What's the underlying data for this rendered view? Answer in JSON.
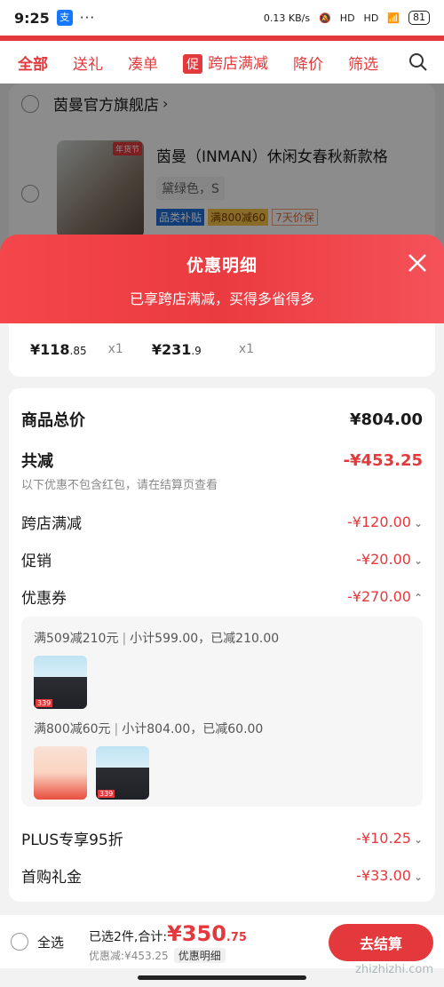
{
  "status_bar": {
    "time": "9:25",
    "app_badge": "支",
    "dots": "···",
    "net_speed": "0.13 KB/s",
    "signal1": "HD",
    "signal2": "HD",
    "battery": "81"
  },
  "tabs": [
    {
      "label": "全部",
      "active": true
    },
    {
      "label": "送礼"
    },
    {
      "label": "凑单"
    },
    {
      "label": "跨店满减",
      "tag": "促"
    },
    {
      "label": "降价"
    },
    {
      "label": "筛选"
    }
  ],
  "store": {
    "name": "茵曼官方旗舰店",
    "product_title": "茵曼（INMAN）休闲女春秋新款格",
    "thumb_label": "年货节",
    "sku": "黛绿色，S",
    "badges": [
      "品类补贴",
      "满800减60",
      "7天价保"
    ]
  },
  "popup": {
    "title": "优惠明细",
    "subtitle": "已享跨店满减，买得多省得多"
  },
  "prices": [
    {
      "main": "¥118",
      "decimal": ".85",
      "qty": "x1"
    },
    {
      "main": "¥231",
      "decimal": ".9",
      "qty": "x1"
    }
  ],
  "details": {
    "total_label": "商品总价",
    "total_value": "¥804.00",
    "reduce_label": "共减",
    "reduce_value": "-¥453.25",
    "note": "以下优惠不包含红包，请在结算页查看",
    "cross_store_label": "跨店满减",
    "cross_store_value": "-¥120.00",
    "promo_label": "促销",
    "promo_value": "-¥20.00",
    "coupon_label": "优惠券",
    "coupon_value": "-¥270.00",
    "plus_label": "PLUS专享95折",
    "plus_value": "-¥10.25",
    "first_label": "首购礼金",
    "first_value": "-¥33.00"
  },
  "coupons": [
    {
      "rule": "满509减210元",
      "subtotal": "小计599.00，已减210.00",
      "thumbs": [
        {
          "kind": "jacket",
          "price": "339"
        }
      ]
    },
    {
      "rule": "满800减60元",
      "subtotal": "小计804.00，已减60.00",
      "thumbs": [
        {
          "kind": "supp",
          "price": ""
        },
        {
          "kind": "jacket",
          "price": "339"
        }
      ]
    }
  ],
  "bottom": {
    "select_all": "全选",
    "selected": "已选2件,合计:",
    "amount_main": "¥350",
    "amount_dec": ".75",
    "discount": "优惠减:¥453.25",
    "detail_btn": "优惠明细",
    "checkout": "去结算"
  },
  "watermark": "zhizhizhi.com",
  "colors": {
    "accent": "#e4393c",
    "header_gradient_start": "#f5464b"
  }
}
